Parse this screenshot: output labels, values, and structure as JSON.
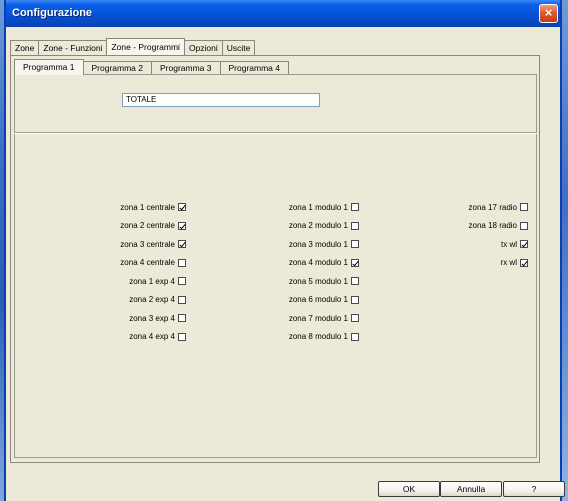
{
  "window": {
    "title": "Configurazione",
    "close_label": "×"
  },
  "main_tabs": [
    {
      "label": "Zone"
    },
    {
      "label": "Zone - Funzioni"
    },
    {
      "label": "Zone - Programmi"
    },
    {
      "label": "Opzioni"
    },
    {
      "label": "Uscite"
    }
  ],
  "active_main_tab": "Zone - Programmi",
  "program_tabs": [
    {
      "label": "Programma 1"
    },
    {
      "label": "Programma 2"
    },
    {
      "label": "Programma 3"
    },
    {
      "label": "Programma 4"
    }
  ],
  "active_program_tab": "Programma 1",
  "program_name": {
    "value": "TOTALE"
  },
  "columns": [
    [
      {
        "label": "zona 1 centrale",
        "checked": true
      },
      {
        "label": "zona 2 centrale",
        "checked": true
      },
      {
        "label": "zona 3 centrale",
        "checked": true
      },
      {
        "label": "zona 4 centrale",
        "checked": false
      },
      {
        "label": "zona 1 exp 4",
        "checked": false
      },
      {
        "label": "zona 2 exp 4",
        "checked": false
      },
      {
        "label": "zona 3 exp 4",
        "checked": false
      },
      {
        "label": "zona 4 exp 4",
        "checked": false
      }
    ],
    [
      {
        "label": "zona 1 modulo 1",
        "checked": false
      },
      {
        "label": "zona 2 modulo 1",
        "checked": false
      },
      {
        "label": "zona 3 modulo 1",
        "checked": false
      },
      {
        "label": "zona 4 modulo 1",
        "checked": true
      },
      {
        "label": "zona 5 modulo 1",
        "checked": false
      },
      {
        "label": "zona 6 modulo 1",
        "checked": false
      },
      {
        "label": "zona 7 modulo 1",
        "checked": false
      },
      {
        "label": "zona 8 modulo 1",
        "checked": false
      }
    ],
    [
      {
        "label": "zona 17 radio",
        "checked": false
      },
      {
        "label": "zona 18 radio",
        "checked": false
      },
      {
        "label": "tx wl",
        "checked": true
      },
      {
        "label": "rx wl",
        "checked": true
      }
    ]
  ],
  "buttons": {
    "ok": "OK",
    "cancel": "Annulla",
    "help": "?"
  }
}
